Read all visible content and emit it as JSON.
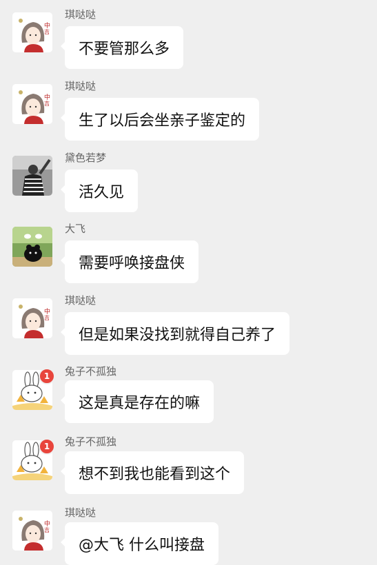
{
  "messages": [
    {
      "sender": "琪哒哒",
      "text": "不要管那么多",
      "avatar": "girl-avatar-icon"
    },
    {
      "sender": "琪哒哒",
      "text": "生了以后会坐亲子鉴定的",
      "avatar": "girl-avatar-icon"
    },
    {
      "sender": "黛色若梦",
      "text": "活久见",
      "avatar": "person-photo-avatar-icon"
    },
    {
      "sender": "大飞",
      "text": "需要呼唤接盘侠",
      "avatar": "cartoon-bear-avatar-icon"
    },
    {
      "sender": "琪哒哒",
      "text": "但是如果没找到就得自己养了",
      "avatar": "girl-avatar-icon"
    },
    {
      "sender": "兔子不孤独",
      "text": "这是真是存在的嘛",
      "avatar": "rabbit-avatar-icon",
      "badge": "1"
    },
    {
      "sender": "兔子不孤独",
      "text": "想不到我也能看到这个",
      "avatar": "rabbit-avatar-icon",
      "badge": "1"
    },
    {
      "sender": "琪哒哒",
      "text": "@大飞 什么叫接盘",
      "avatar": "girl-avatar-icon"
    }
  ],
  "colors": {
    "background": "#efefef",
    "bubble": "#ffffff",
    "badge": "#e8453c"
  }
}
